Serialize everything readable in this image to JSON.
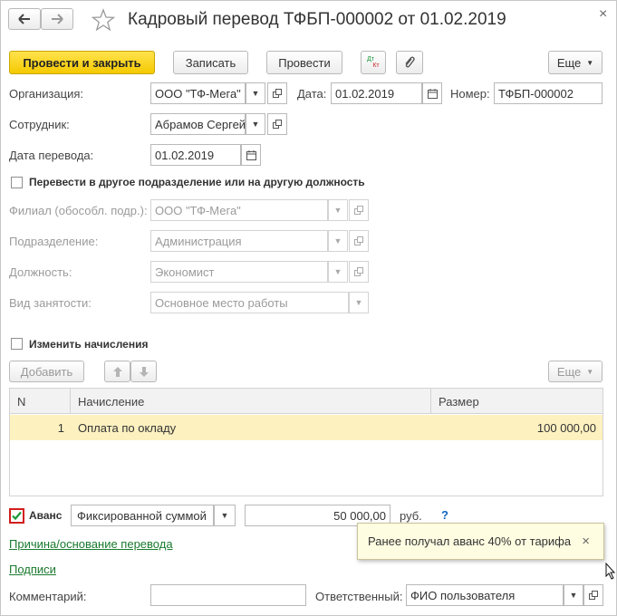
{
  "window": {
    "title": "Кадровый перевод ТФБП-000002 от 01.02.2019",
    "close_glyph": "×"
  },
  "toolbar": {
    "post_close": "Провести и закрыть",
    "save": "Записать",
    "post": "Провести",
    "dtkt_top": "Дт",
    "dtkt_bottom": "Кт",
    "more": "Еще"
  },
  "header": {
    "org_label": "Организация:",
    "org_value": "ООО \"ТФ-Мега\"",
    "date_label": "Дата:",
    "date_value": "01.02.2019",
    "number_label": "Номер:",
    "number_value": "ТФБП-000002"
  },
  "employee": {
    "label": "Сотрудник:",
    "value": "Абрамов Сергей"
  },
  "transfer_date": {
    "label": "Дата перевода:",
    "value": "01.02.2019"
  },
  "transfer": {
    "checkbox_label": "Перевести в другое подразделение или на другую должность",
    "checked": false,
    "branch_label": "Филиал (обособл. подр.):",
    "branch_value": "ООО \"ТФ-Мега\"",
    "department_label": "Подразделение:",
    "department_value": "Администрация",
    "position_label": "Должность:",
    "position_value": "Экономист",
    "employment_label": "Вид занятости:",
    "employment_value": "Основное место работы"
  },
  "accruals": {
    "checkbox_label": "Изменить начисления",
    "checked": false,
    "add_label": "Добавить",
    "more": "Еще",
    "columns": [
      "N",
      "Начисление",
      "Размер"
    ],
    "rows": [
      {
        "n": "1",
        "name": "Оплата по окладу",
        "amount": "100 000,00"
      }
    ]
  },
  "advance": {
    "label": "Аванс",
    "checked": true,
    "mode": "Фиксированной суммой",
    "amount": "50 000,00",
    "currency": "руб.",
    "help": "?",
    "tooltip": "Ранее получал аванс 40% от тарифа",
    "tooltip_close": "×"
  },
  "links": {
    "reason": "Причина/основание перевода",
    "signatures": "Подписи"
  },
  "footer": {
    "comment_label": "Комментарий:",
    "comment_value": "",
    "responsible_label": "Ответственный:",
    "responsible_value": "ФИО пользователя"
  },
  "colors": {
    "primary_button": "#f5c900",
    "selected_row": "#fdf1c0",
    "link": "#1a7a2f",
    "checkbox_check": "#1a9a3a",
    "checkbox_highlight": "#d21d1d"
  }
}
